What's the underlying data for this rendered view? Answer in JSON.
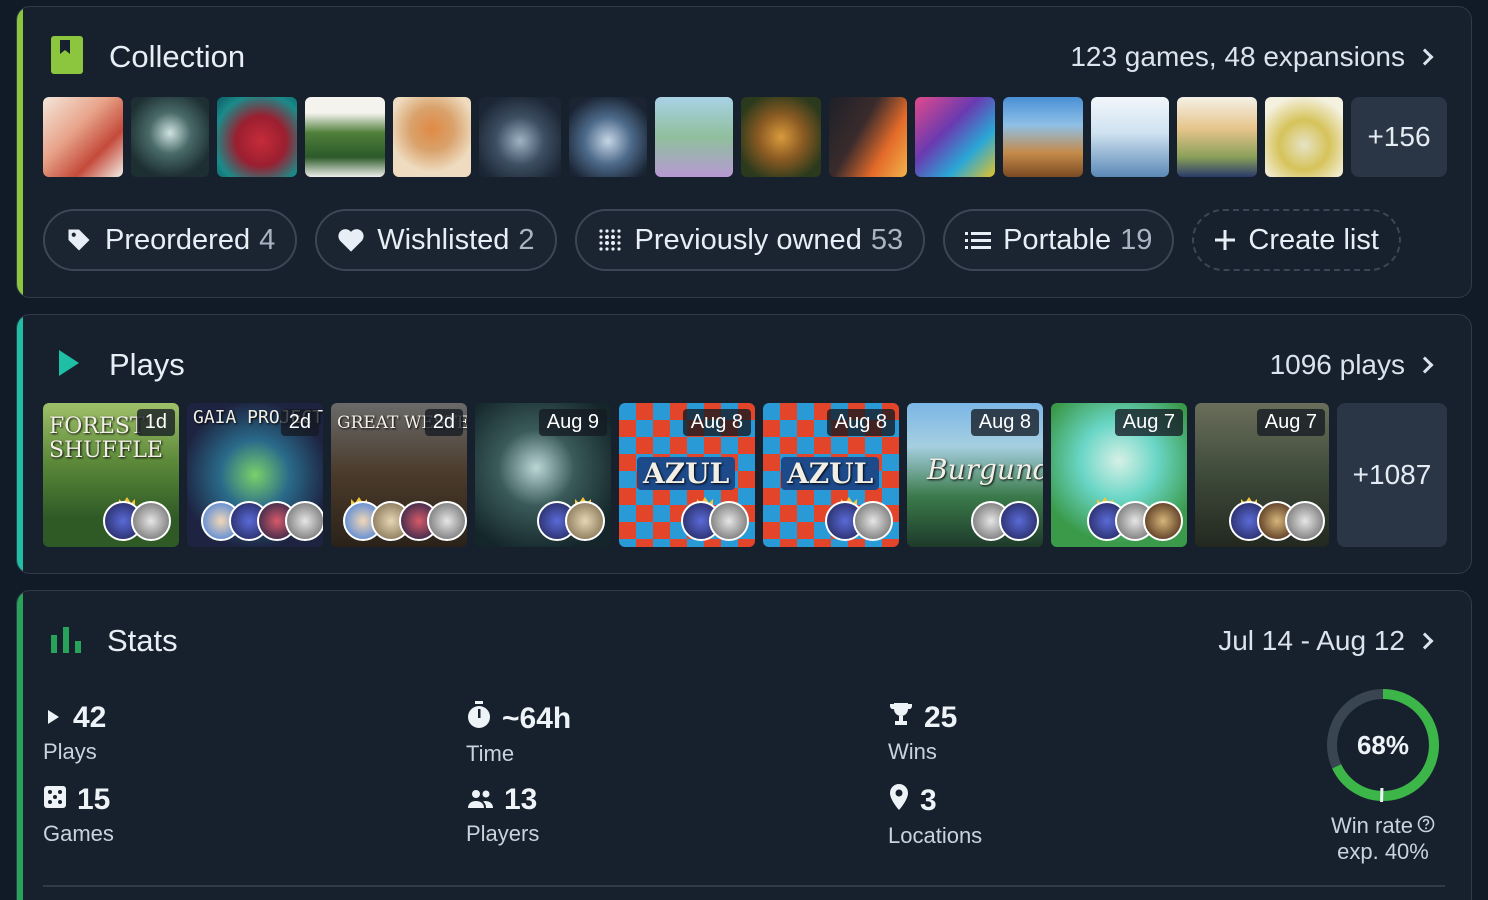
{
  "collection": {
    "title": "Collection",
    "summary": "123 games, 48 expansions",
    "more": "+156",
    "accent": "#8cc63f",
    "chips": [
      {
        "icon": "tag-icon",
        "label": "Preordered",
        "count": "4"
      },
      {
        "icon": "heart-icon",
        "label": "Wishlisted",
        "count": "2"
      },
      {
        "icon": "dots-grid-icon",
        "label": "Previously owned",
        "count": "53"
      },
      {
        "icon": "list-icon",
        "label": "Portable",
        "count": "19"
      },
      {
        "icon": "plus-icon",
        "label": "Create list",
        "count": ""
      }
    ]
  },
  "plays": {
    "title": "Plays",
    "summary": "1096 plays",
    "more": "+1087",
    "accent": "#1fbfa5",
    "items": [
      {
        "date": "1d",
        "cover_text": "FOREST SHUFFLE"
      },
      {
        "date": "2d",
        "cover_text": "GAIA PROJECT"
      },
      {
        "date": "2d",
        "cover_text": "GREAT WESTERN TRAIL"
      },
      {
        "date": "Aug 9",
        "cover_text": ""
      },
      {
        "date": "Aug 8",
        "cover_text": "AZUL"
      },
      {
        "date": "Aug 8",
        "cover_text": "AZUL"
      },
      {
        "date": "Aug 8",
        "cover_text": "Burgundy"
      },
      {
        "date": "Aug 7",
        "cover_text": ""
      },
      {
        "date": "Aug 7",
        "cover_text": ""
      }
    ]
  },
  "stats": {
    "title": "Stats",
    "summary": "Jul 14 - Aug 12",
    "accent": "#27a35a",
    "items": [
      {
        "icon": "play-icon",
        "value": "42",
        "label": "Plays"
      },
      {
        "icon": "timer-icon",
        "value": "~64h",
        "label": "Time"
      },
      {
        "icon": "trophy-icon",
        "value": "25",
        "label": "Wins"
      },
      {
        "icon": "dice-icon",
        "value": "15",
        "label": "Games"
      },
      {
        "icon": "players-icon",
        "value": "13",
        "label": "Players"
      },
      {
        "icon": "location-icon",
        "value": "3",
        "label": "Locations"
      }
    ],
    "win_rate": {
      "percent": 68,
      "percent_text": "68%",
      "label": "Win rate",
      "expected": "exp. 40%",
      "color": "#3cb549"
    }
  }
}
